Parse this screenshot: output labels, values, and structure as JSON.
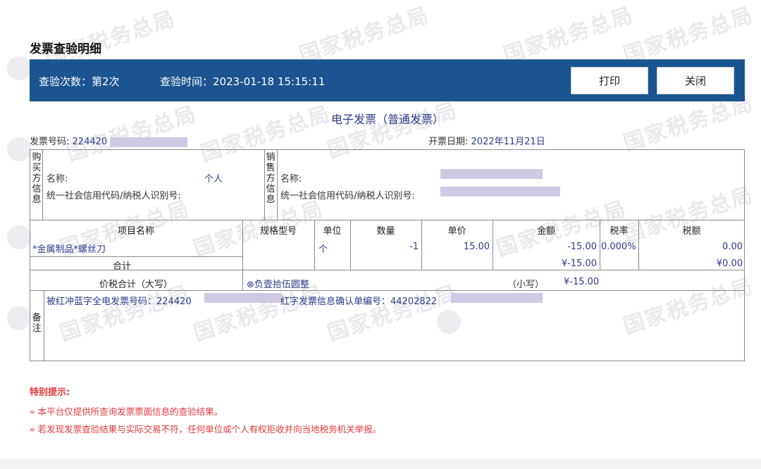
{
  "page": {
    "title": "发票查验明细"
  },
  "topbar": {
    "check_count": "查验次数：第2次",
    "check_time": "查验时间：2023-01-18 15:15:11",
    "print_label": "打印",
    "close_label": "关闭",
    "bg_color": "#1a5491"
  },
  "invoice": {
    "title": "电子发票（普通发票）",
    "number_label": "发票号码:",
    "number_value": "224420",
    "date_label": "开票日期:",
    "date_value": "2022年11月21日",
    "buyer": {
      "side_label": [
        "购",
        "买",
        "方",
        "信",
        "息"
      ],
      "name_label": "名称:",
      "name_value": "个人",
      "tax_id_label": "统一社会信用代码/纳税人识别号:"
    },
    "seller": {
      "side_label": [
        "销",
        "售",
        "方",
        "信",
        "息"
      ],
      "name_label": "名称:",
      "tax_id_label": "统一社会信用代码/纳税人识别号:"
    },
    "columns": {
      "item": "项目名称",
      "spec": "规格型号",
      "unit": "单位",
      "qty": "数量",
      "price": "单价",
      "amount": "金额",
      "rate": "税率",
      "tax": "税额"
    },
    "items": [
      {
        "item": "*金属制品*螺丝刀",
        "spec": "",
        "unit": "个",
        "qty": "-1",
        "price": "15.00",
        "amount": "-15.00",
        "rate": "0.000%",
        "tax": "0.00"
      }
    ],
    "subtotal": {
      "label": "合计",
      "amount": "¥-15.00",
      "tax": "¥0.00"
    },
    "total": {
      "label": "价税合计（大写）",
      "words": "⊗负壹拾伍圆整",
      "small_label": "（小写）",
      "small_value": "¥-15.00"
    },
    "remarks": {
      "side_label": [
        "备",
        "注"
      ],
      "red_blue_label": "被红冲蓝字全电发票号码：224420",
      "red_confirm_label": "红字发票信息确认单编号：44202822"
    }
  },
  "tips": {
    "title": "特别提示:",
    "items": [
      "» 本平台仅提供所查询发票票面信息的查验结果。",
      "» 若发现发票查验结果与实际交易不符，任何单位或个人有权拒收并向当地税务机关举报。"
    ]
  },
  "watermark": {
    "text": "国家税务总局"
  }
}
